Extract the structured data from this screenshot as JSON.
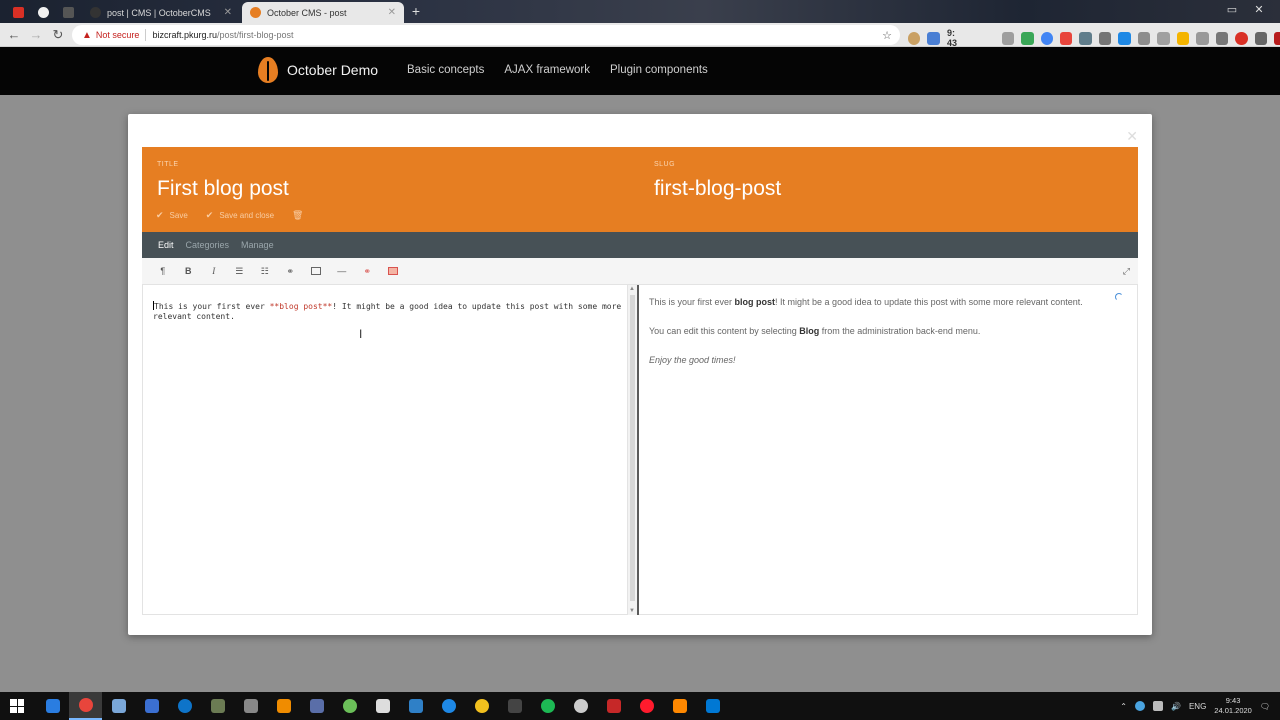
{
  "browser": {
    "tabs": [
      {
        "label": "",
        "favicon": "gmail-icon",
        "color": "#d93025"
      },
      {
        "label": "",
        "favicon": "web-icon",
        "color": "#ffffff"
      },
      {
        "label": "",
        "favicon": "github-icon",
        "color": "#555555"
      },
      {
        "label": "post | CMS | OctoberCMS",
        "favicon": "github-icon",
        "color": "#333333"
      },
      {
        "label": "October CMS - post",
        "favicon": "october-icon",
        "color": "#e67e22"
      }
    ],
    "address": {
      "security_label": "Not secure",
      "host": "bizcraft.pkurg.ru",
      "path": "/post/first-blog-post"
    },
    "toolbar_clock": "9:  43"
  },
  "site": {
    "brand": "October Demo",
    "nav": [
      "Basic concepts",
      "AJAX framework",
      "Plugin components"
    ]
  },
  "form": {
    "title_label": "TITLE",
    "title_value": "First blog post",
    "slug_label": "SLUG",
    "slug_value": "first-blog-post",
    "save_label": "Save",
    "save_close_label": "Save and close",
    "tabs": [
      "Edit",
      "Categories",
      "Manage"
    ],
    "tools": {
      "paragraph": "¶",
      "bold": "B",
      "italic": "I",
      "ul": "☰",
      "ol": "☷",
      "link": "⚭",
      "hr": "—",
      "link_alt": "⚭"
    }
  },
  "editor": {
    "before": "his is your first ever ",
    "first_char": "T",
    "md_bold": "**blog post**",
    "after": "! It might be a good idea to update this post with some more relevant content."
  },
  "preview": {
    "p1_a": "This is your first ever ",
    "p1_b": "blog post",
    "p1_c": "! It might be a good idea to update this post with some more relevant content.",
    "p2_a": "You can edit this content by selecting ",
    "p2_b": "Blog",
    "p2_c": " from the administration back-end menu.",
    "p3": "Enjoy the good times!"
  },
  "taskbar": {
    "lang": "ENG",
    "time": "9:43",
    "date": "24.01.2020"
  },
  "colors": {
    "accent": "#e67e22",
    "tabs_bar": "#475156",
    "header_bg": "#050505"
  }
}
